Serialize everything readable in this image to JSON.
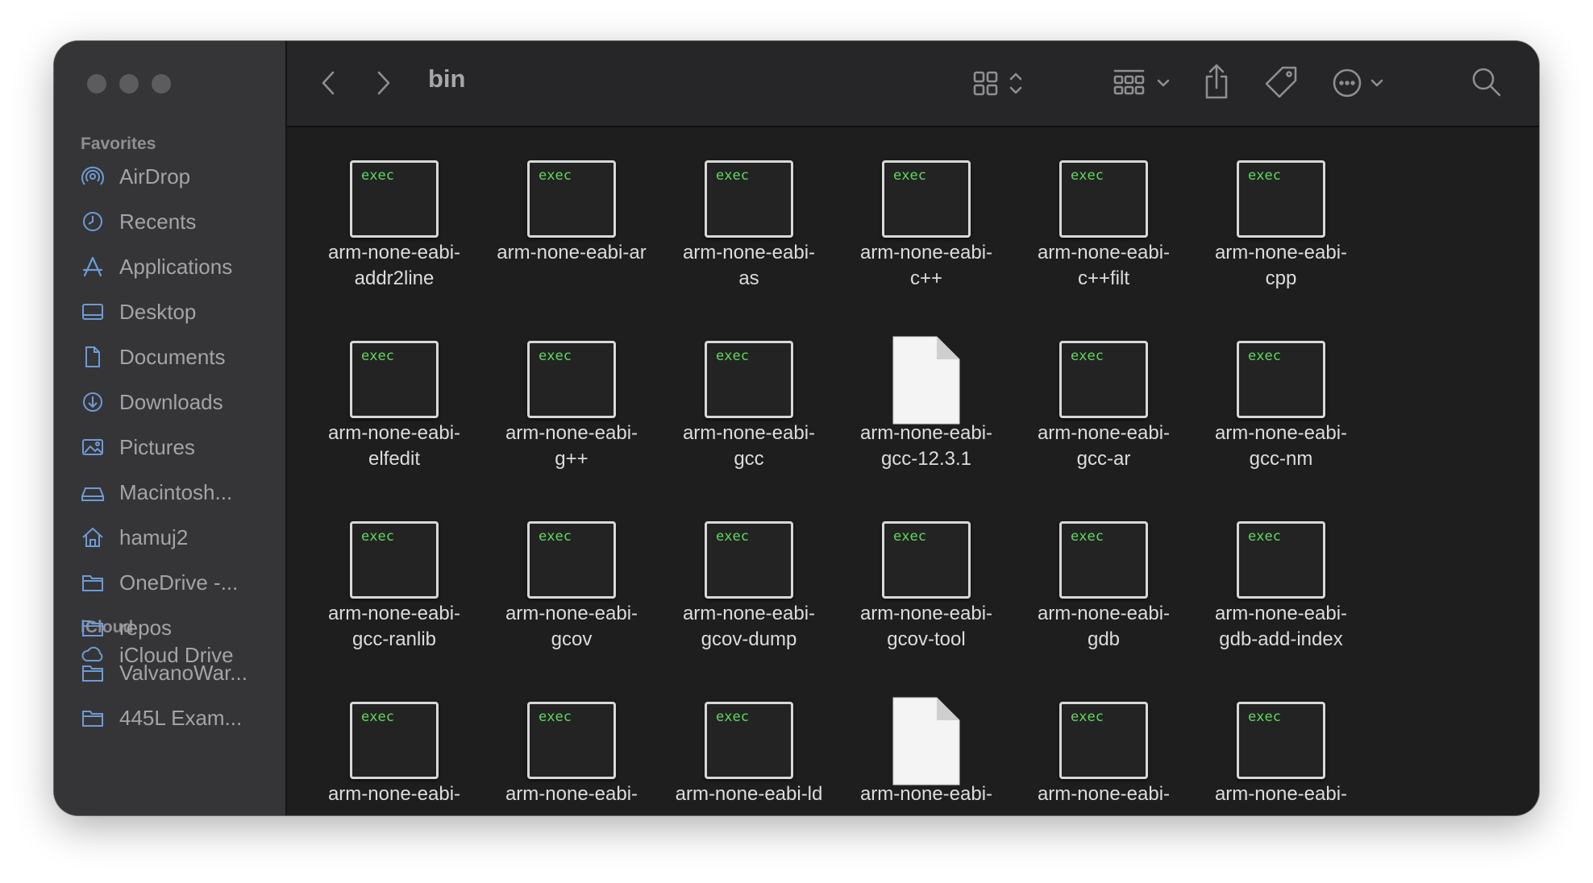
{
  "sidebar": {
    "favorites_heading": "Favorites",
    "icloud_heading": "iCloud",
    "items": [
      {
        "label": "AirDrop",
        "icon": "airdrop-icon"
      },
      {
        "label": "Recents",
        "icon": "clock-icon"
      },
      {
        "label": "Applications",
        "icon": "applications-icon"
      },
      {
        "label": "Desktop",
        "icon": "desktop-icon"
      },
      {
        "label": "Documents",
        "icon": "document-icon"
      },
      {
        "label": "Downloads",
        "icon": "download-icon"
      },
      {
        "label": "Pictures",
        "icon": "pictures-icon"
      },
      {
        "label": "Macintosh...",
        "icon": "drive-icon"
      },
      {
        "label": "hamuj2",
        "icon": "home-icon"
      },
      {
        "label": "OneDrive -...",
        "icon": "folder-icon"
      },
      {
        "label": "repos",
        "icon": "folder-icon"
      },
      {
        "label": "ValvanoWar...",
        "icon": "folder-icon"
      },
      {
        "label": "445L Exam...",
        "icon": "folder-icon"
      }
    ],
    "icloud_items": [
      {
        "label": "iCloud Drive",
        "icon": "icloud-icon"
      }
    ]
  },
  "toolbar": {
    "title": "bin",
    "icons": [
      "back-icon",
      "forward-icon",
      "grid-view-icon",
      "group-icon",
      "share-icon",
      "tag-icon",
      "more-icon",
      "search-icon"
    ]
  },
  "files": [
    {
      "name": "arm-none-eabi-\naddr2line",
      "kind": "exec"
    },
    {
      "name": "arm-none-eabi-ar",
      "kind": "exec"
    },
    {
      "name": "arm-none-eabi-\nas",
      "kind": "exec"
    },
    {
      "name": "arm-none-eabi-\nc++",
      "kind": "exec"
    },
    {
      "name": "arm-none-eabi-\nc++filt",
      "kind": "exec"
    },
    {
      "name": "arm-none-eabi-\ncpp",
      "kind": "exec"
    },
    {
      "name": "arm-none-eabi-\nelfedit",
      "kind": "exec"
    },
    {
      "name": "arm-none-eabi-\ng++",
      "kind": "exec"
    },
    {
      "name": "arm-none-eabi-\ngcc",
      "kind": "exec"
    },
    {
      "name": "arm-none-eabi-\ngcc-12.3.1",
      "kind": "document"
    },
    {
      "name": "arm-none-eabi-\ngcc-ar",
      "kind": "exec"
    },
    {
      "name": "arm-none-eabi-\ngcc-nm",
      "kind": "exec"
    },
    {
      "name": "arm-none-eabi-\ngcc-ranlib",
      "kind": "exec"
    },
    {
      "name": "arm-none-eabi-\ngcov",
      "kind": "exec"
    },
    {
      "name": "arm-none-eabi-\ngcov-dump",
      "kind": "exec"
    },
    {
      "name": "arm-none-eabi-\ngcov-tool",
      "kind": "exec"
    },
    {
      "name": "arm-none-eabi-\ngdb",
      "kind": "exec"
    },
    {
      "name": "arm-none-eabi-\ngdb-add-index",
      "kind": "exec"
    },
    {
      "name": "arm-none-eabi-",
      "kind": "exec"
    },
    {
      "name": "arm-none-eabi-",
      "kind": "exec"
    },
    {
      "name": "arm-none-eabi-ld",
      "kind": "exec"
    },
    {
      "name": "arm-none-eabi-",
      "kind": "document"
    },
    {
      "name": "arm-none-eabi-",
      "kind": "exec"
    },
    {
      "name": "arm-none-eabi-",
      "kind": "exec"
    }
  ],
  "exec_badge": "exec"
}
